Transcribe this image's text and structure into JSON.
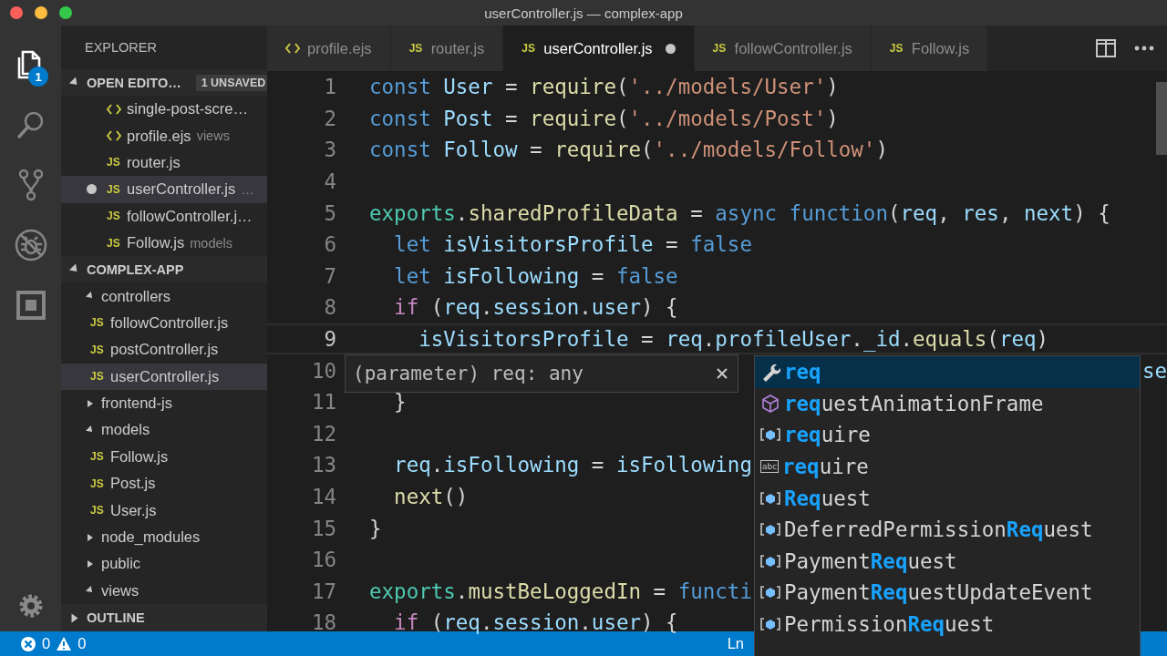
{
  "window": {
    "title": "userController.js — complex-app"
  },
  "activity_bar": {
    "items": [
      {
        "kind": "files",
        "selected": true,
        "badge": "1"
      },
      {
        "kind": "search",
        "selected": false
      },
      {
        "kind": "source-control",
        "selected": false
      },
      {
        "kind": "debug",
        "selected": false
      },
      {
        "kind": "extensions",
        "selected": false
      }
    ]
  },
  "sidebar": {
    "title": "EXPLORER",
    "open_editors": {
      "title": "OPEN EDITO…",
      "badge": "1 UNSAVED",
      "expanded": true,
      "items": [
        {
          "kind": "ejs",
          "name": "single-post-scre…",
          "dirty": false,
          "selected": false
        },
        {
          "kind": "ejs",
          "name": "profile.ejs",
          "description": "views",
          "dirty": false,
          "selected": false
        },
        {
          "kind": "js",
          "icon": "JS",
          "name": "router.js",
          "dirty": false,
          "selected": false
        },
        {
          "kind": "js",
          "icon": "JS",
          "name": "userController.js",
          "description": "…",
          "dirty": true,
          "selected": true
        },
        {
          "kind": "js",
          "icon": "JS",
          "name": "followController.j…",
          "dirty": false,
          "selected": false
        },
        {
          "kind": "js",
          "icon": "JS",
          "name": "Follow.js",
          "description": "models",
          "dirty": false,
          "selected": false
        }
      ]
    },
    "folder": {
      "title": "COMPLEX-APP",
      "expanded": true,
      "tree": [
        {
          "kind": "folder",
          "name": "controllers",
          "expanded": true,
          "children": [
            {
              "kind": "js",
              "icon": "JS",
              "name": "followController.js",
              "selected": false
            },
            {
              "kind": "js",
              "icon": "JS",
              "name": "postController.js",
              "selected": false
            },
            {
              "kind": "js",
              "icon": "JS",
              "name": "userController.js",
              "selected": true
            }
          ]
        },
        {
          "kind": "folder",
          "name": "frontend-js",
          "expanded": false
        },
        {
          "kind": "folder",
          "name": "models",
          "expanded": true,
          "children": [
            {
              "kind": "js",
              "icon": "JS",
              "name": "Follow.js",
              "selected": false
            },
            {
              "kind": "js",
              "icon": "JS",
              "name": "Post.js",
              "selected": false
            },
            {
              "kind": "js",
              "icon": "JS",
              "name": "User.js",
              "selected": false
            }
          ]
        },
        {
          "kind": "folder",
          "name": "node_modules",
          "expanded": false
        },
        {
          "kind": "folder",
          "name": "public",
          "expanded": false
        },
        {
          "kind": "folder",
          "name": "views",
          "expanded": true
        }
      ]
    },
    "outline": {
      "title": "OUTLINE",
      "expanded": false
    }
  },
  "tabs": [
    {
      "kind": "ejs",
      "label": "profile.ejs",
      "selected": false,
      "dirty": false
    },
    {
      "kind": "js",
      "icon": "JS",
      "label": "router.js",
      "selected": false,
      "dirty": false
    },
    {
      "kind": "js",
      "icon": "JS",
      "label": "userController.js",
      "selected": true,
      "dirty": true
    },
    {
      "kind": "js",
      "icon": "JS",
      "label": "followController.js",
      "selected": false,
      "dirty": false
    },
    {
      "kind": "js",
      "icon": "JS",
      "label": "Follow.js",
      "selected": false,
      "dirty": false
    }
  ],
  "editor": {
    "lines": [
      {
        "number": "1",
        "current": false,
        "tokens": [
          {
            "kind": "keyword",
            "text": "const "
          },
          {
            "kind": "variable",
            "text": "User"
          },
          {
            "kind": "plain",
            "text": " = "
          },
          {
            "kind": "function",
            "text": "require"
          },
          {
            "kind": "plain",
            "text": "("
          },
          {
            "kind": "string",
            "text": "'../models/User'"
          },
          {
            "kind": "plain",
            "text": ")"
          }
        ]
      },
      {
        "number": "2",
        "current": false,
        "tokens": [
          {
            "kind": "keyword",
            "text": "const "
          },
          {
            "kind": "variable",
            "text": "Post"
          },
          {
            "kind": "plain",
            "text": " = "
          },
          {
            "kind": "function",
            "text": "require"
          },
          {
            "kind": "plain",
            "text": "("
          },
          {
            "kind": "string",
            "text": "'../models/Post'"
          },
          {
            "kind": "plain",
            "text": ")"
          }
        ]
      },
      {
        "number": "3",
        "current": false,
        "tokens": [
          {
            "kind": "keyword",
            "text": "const "
          },
          {
            "kind": "variable",
            "text": "Follow"
          },
          {
            "kind": "plain",
            "text": " = "
          },
          {
            "kind": "function",
            "text": "require"
          },
          {
            "kind": "plain",
            "text": "("
          },
          {
            "kind": "string",
            "text": "'../models/Follow'"
          },
          {
            "kind": "plain",
            "text": ")"
          }
        ]
      },
      {
        "number": "4",
        "current": false
      },
      {
        "number": "5",
        "current": false,
        "tokens": [
          {
            "kind": "class",
            "text": "exports"
          },
          {
            "kind": "plain",
            "text": "."
          },
          {
            "kind": "function",
            "text": "sharedProfileData"
          },
          {
            "kind": "plain",
            "text": " = "
          },
          {
            "kind": "keyword",
            "text": "async function"
          },
          {
            "kind": "plain",
            "text": "("
          },
          {
            "kind": "variable",
            "text": "req"
          },
          {
            "kind": "plain",
            "text": ", "
          },
          {
            "kind": "variable",
            "text": "res"
          },
          {
            "kind": "plain",
            "text": ", "
          },
          {
            "kind": "variable",
            "text": "next"
          },
          {
            "kind": "plain",
            "text": ") {"
          }
        ]
      },
      {
        "number": "6",
        "current": false,
        "tokens": [
          {
            "kind": "keyword",
            "text": "  let "
          },
          {
            "kind": "variable",
            "text": "isVisitorsProfile"
          },
          {
            "kind": "plain",
            "text": " = "
          },
          {
            "kind": "keyword",
            "text": "false"
          }
        ]
      },
      {
        "number": "7",
        "current": false,
        "tokens": [
          {
            "kind": "keyword",
            "text": "  let "
          },
          {
            "kind": "variable",
            "text": "isFollowing"
          },
          {
            "kind": "plain",
            "text": " = "
          },
          {
            "kind": "keyword",
            "text": "false"
          }
        ]
      },
      {
        "number": "8",
        "current": false,
        "tokens": [
          {
            "kind": "control",
            "text": "  if"
          },
          {
            "kind": "plain",
            "text": " ("
          },
          {
            "kind": "variable",
            "text": "req"
          },
          {
            "kind": "plain",
            "text": "."
          },
          {
            "kind": "variable",
            "text": "session"
          },
          {
            "kind": "plain",
            "text": "."
          },
          {
            "kind": "variable",
            "text": "user"
          },
          {
            "kind": "plain",
            "text": ") {"
          }
        ]
      },
      {
        "number": "9",
        "current": true,
        "tokens": [
          {
            "kind": "variable",
            "text": "    isVisitorsProfile"
          },
          {
            "kind": "plain",
            "text": " = "
          },
          {
            "kind": "variable",
            "text": "req"
          },
          {
            "kind": "plain",
            "text": "."
          },
          {
            "kind": "variable",
            "text": "profileUser"
          },
          {
            "kind": "plain",
            "text": "."
          },
          {
            "kind": "variable",
            "text": "_id"
          },
          {
            "kind": "plain",
            "text": "."
          },
          {
            "kind": "function",
            "text": "equals"
          },
          {
            "kind": "plain",
            "text": "("
          },
          {
            "kind": "variable",
            "text": "req"
          },
          {
            "kind": "plain",
            "text": ")"
          }
        ]
      },
      {
        "number": "10",
        "current": false,
        "tail": "se"
      },
      {
        "number": "11",
        "current": false,
        "tokens": [
          {
            "kind": "plain",
            "text": "  }"
          }
        ]
      },
      {
        "number": "12",
        "current": false
      },
      {
        "number": "13",
        "current": false,
        "tokens": [
          {
            "kind": "variable",
            "text": "  req"
          },
          {
            "kind": "plain",
            "text": "."
          },
          {
            "kind": "variable",
            "text": "isFollowing"
          },
          {
            "kind": "plain",
            "text": " = "
          },
          {
            "kind": "variable",
            "text": "isFollowing"
          }
        ]
      },
      {
        "number": "14",
        "current": false,
        "tokens": [
          {
            "kind": "function",
            "text": "  next"
          },
          {
            "kind": "plain",
            "text": "()"
          }
        ]
      },
      {
        "number": "15",
        "current": false,
        "tokens": [
          {
            "kind": "plain",
            "text": "}"
          }
        ]
      },
      {
        "number": "16",
        "current": false
      },
      {
        "number": "17",
        "current": false,
        "tokens": [
          {
            "kind": "class",
            "text": "exports"
          },
          {
            "kind": "plain",
            "text": "."
          },
          {
            "kind": "function",
            "text": "mustBeLoggedIn"
          },
          {
            "kind": "plain",
            "text": " = "
          },
          {
            "kind": "keyword",
            "text": "functi"
          }
        ]
      },
      {
        "number": "18",
        "current": false,
        "tokens": [
          {
            "kind": "control",
            "text": "  if"
          },
          {
            "kind": "plain",
            "text": " ("
          },
          {
            "kind": "variable",
            "text": "req"
          },
          {
            "kind": "plain",
            "text": "."
          },
          {
            "kind": "variable",
            "text": "session"
          },
          {
            "kind": "plain",
            "text": "."
          },
          {
            "kind": "variable",
            "text": "user"
          },
          {
            "kind": "plain",
            "text": ") {"
          }
        ]
      }
    ],
    "hover": {
      "text": "(parameter) req: any"
    },
    "suggest": {
      "items": [
        {
          "kind": "property",
          "label": "**req**",
          "selected": true
        },
        {
          "kind": "module",
          "label": "**req**uestAnimationFrame",
          "selected": false
        },
        {
          "kind": "variable",
          "label": "**req**uire",
          "selected": false
        },
        {
          "kind": "text",
          "icon": "abc",
          "label": "**req**uire",
          "selected": false
        },
        {
          "kind": "variable",
          "label": "**Req**uest",
          "selected": false
        },
        {
          "kind": "variable",
          "label": "DeferredPermission**Req**uest",
          "selected": false
        },
        {
          "kind": "variable",
          "label": "Payment**Req**uest",
          "selected": false
        },
        {
          "kind": "variable",
          "label": "Payment**Req**uestUpdateEvent",
          "selected": false
        },
        {
          "kind": "variable",
          "label": "Permission**Req**uest",
          "selected": false
        }
      ]
    }
  },
  "status_bar": {
    "errors": "0",
    "warnings": "0",
    "position": "Ln"
  }
}
